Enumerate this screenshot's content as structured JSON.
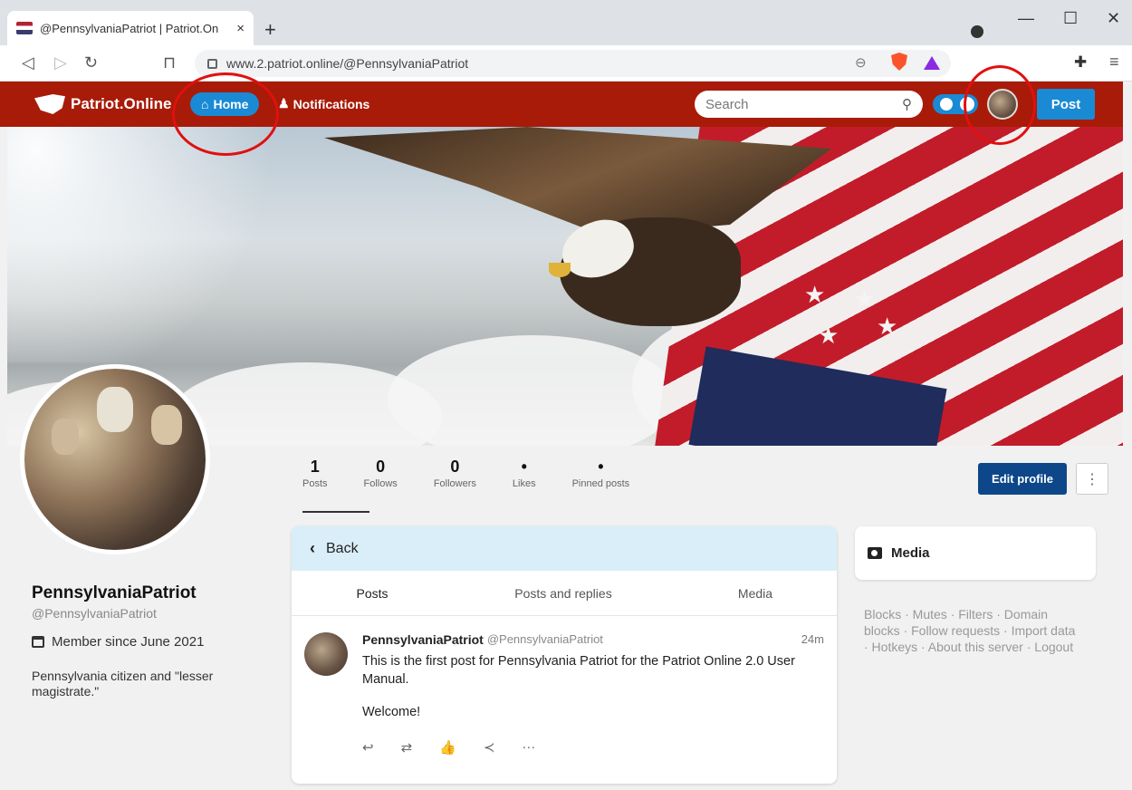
{
  "browser": {
    "tab_title": "@PennsylvaniaPatriot | Patriot.On",
    "tab_close": "×",
    "new_tab": "+",
    "url": "www.2.patriot.online/@PennsylvaniaPatriot",
    "window_min": "—",
    "window_max": "☐",
    "window_close": "✕"
  },
  "nav": {
    "logo_text": "Patriot.Online",
    "home_label": "Home",
    "notifications_label": "Notifications",
    "search_placeholder": "Search",
    "post_label": "Post"
  },
  "profile": {
    "stats": [
      {
        "num": "1",
        "label": "Posts"
      },
      {
        "num": "0",
        "label": "Follows"
      },
      {
        "num": "0",
        "label": "Followers"
      },
      {
        "num": "•",
        "label": "Likes"
      },
      {
        "num": "•",
        "label": "Pinned posts"
      }
    ],
    "edit_label": "Edit profile",
    "name": "PennsylvaniaPatriot",
    "handle": "@PennsylvaniaPatriot",
    "member_since": "Member since June 2021",
    "bio": "Pennsylvania citizen and \"lesser magistrate.\""
  },
  "feed": {
    "back_label": "Back",
    "tabs": [
      "Posts",
      "Posts and replies",
      "Media"
    ],
    "post": {
      "author": "PennsylvaniaPatriot",
      "handle": "@PennsylvaniaPatriot",
      "time": "24m",
      "text": "This is the first post for Pennsylvania Patriot for the Patriot Online 2.0 User Manual.",
      "welcome": "Welcome!"
    }
  },
  "sidebar": {
    "media_label": "Media",
    "footer": "Blocks · Mutes · Filters · Domain blocks · Follow requests · Import data · Hotkeys · About this server · Logout"
  },
  "colors": {
    "nav_bg": "#a81b08",
    "accent": "#1a8ad4",
    "edit_btn": "#0d4789",
    "annotation": "#e01010"
  }
}
